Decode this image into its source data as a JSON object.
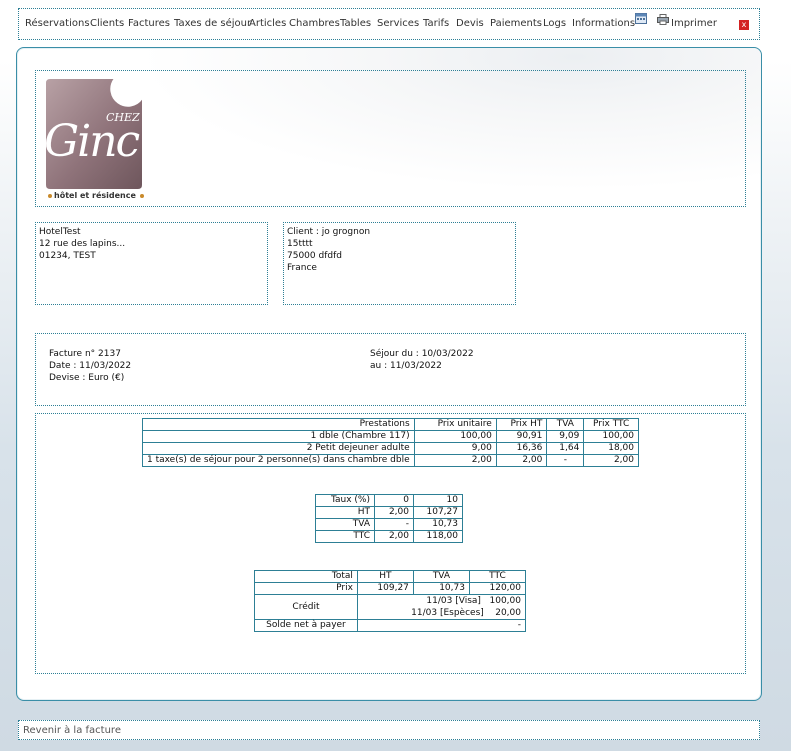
{
  "nav": {
    "items": [
      "Réservations",
      "Clients",
      "Factures",
      "Taxes de séjour",
      "Articles",
      "Chambres",
      "Tables",
      "Services",
      "Tarifs",
      "Devis",
      "Paiements",
      "Logs",
      "Informations"
    ],
    "print_label": "Imprimer",
    "close_label": "x"
  },
  "logo": {
    "brand_top": "CHEZ",
    "brand_name": "Ginc",
    "tagline": "hôtel et résidence"
  },
  "hotel": {
    "name": "HotelTest",
    "street": "12 rue des lapins...",
    "city": "01234, TEST"
  },
  "client": {
    "name_line": "Client : jo grognon",
    "line2": "15tttt",
    "line3": "75000 dfdfd",
    "country": "France"
  },
  "invoice": {
    "number": "Facture n° 2137",
    "date": "Date : 11/03/2022",
    "currency": "Devise : Euro (€)",
    "stay_from": "Séjour du : 10/03/2022",
    "stay_to": "au : 11/03/2022"
  },
  "services_table": {
    "headers": [
      "Prestations",
      "Prix unitaire",
      "Prix HT",
      "TVA",
      "Prix TTC"
    ],
    "rows": [
      [
        "1 dble (Chambre 117)",
        "100,00",
        "90,91",
        "9,09",
        "100,00"
      ],
      [
        "2 Petit dejeuner adulte",
        "9,00",
        "16,36",
        "1,64",
        "18,00"
      ],
      [
        "1 taxe(s) de séjour pour 2 personne(s) dans chambre dble",
        "2,00",
        "2,00",
        "-",
        "2,00"
      ]
    ]
  },
  "tax_table": {
    "headers": [
      "Taux (%)",
      "0",
      "10"
    ],
    "rows": [
      [
        "HT",
        "2,00",
        "107,27"
      ],
      [
        "TVA",
        "-",
        "10,73"
      ],
      [
        "TTC",
        "2,00",
        "118,00"
      ]
    ]
  },
  "totals_table": {
    "headers": [
      "Total",
      "HT",
      "TVA",
      "TTC"
    ],
    "price_row": [
      "Prix",
      "109,27",
      "10,73",
      "120,00"
    ],
    "credit_label": "Crédit",
    "credits": [
      {
        "label": "11/03 [Visa]",
        "amount": "100,00"
      },
      {
        "label": "11/03 [Espèces]",
        "amount": "20,00"
      }
    ],
    "balance_label": "Solde net à payer",
    "balance_value": "-"
  },
  "footer": {
    "back_link": "Revenir à la facture"
  }
}
